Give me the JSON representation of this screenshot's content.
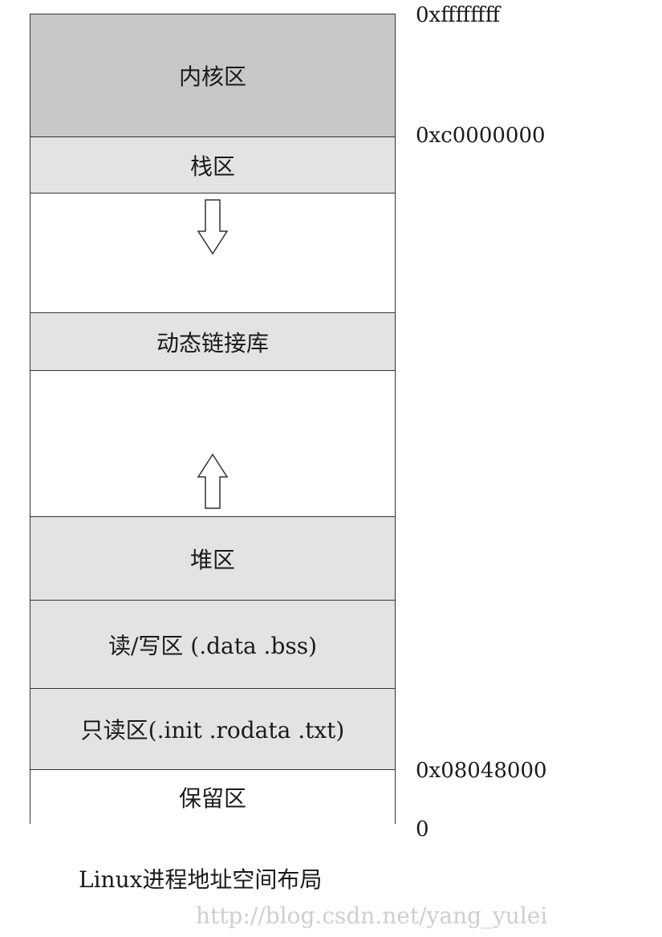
{
  "diagram": {
    "segments": {
      "kernel": "内核区",
      "stack": "栈区",
      "stack_growth": "",
      "dynlib": "动态链接库",
      "heap_growth": "",
      "heap": "堆区",
      "rw": "读/写区 (.data .bss)",
      "ro": "只读区(.init .rodata .txt)",
      "reserved": "保留区"
    },
    "addresses": {
      "top": "0xffffffff",
      "kernel_start": "0xc0000000",
      "text_start": "0x08048000",
      "zero": "0"
    },
    "arrows": {
      "stack_direction": "down-arrow",
      "heap_direction": "up-arrow"
    }
  },
  "caption": "Linux进程地址空间布局",
  "watermark": "http://blog.csdn.net/yang_yulei"
}
